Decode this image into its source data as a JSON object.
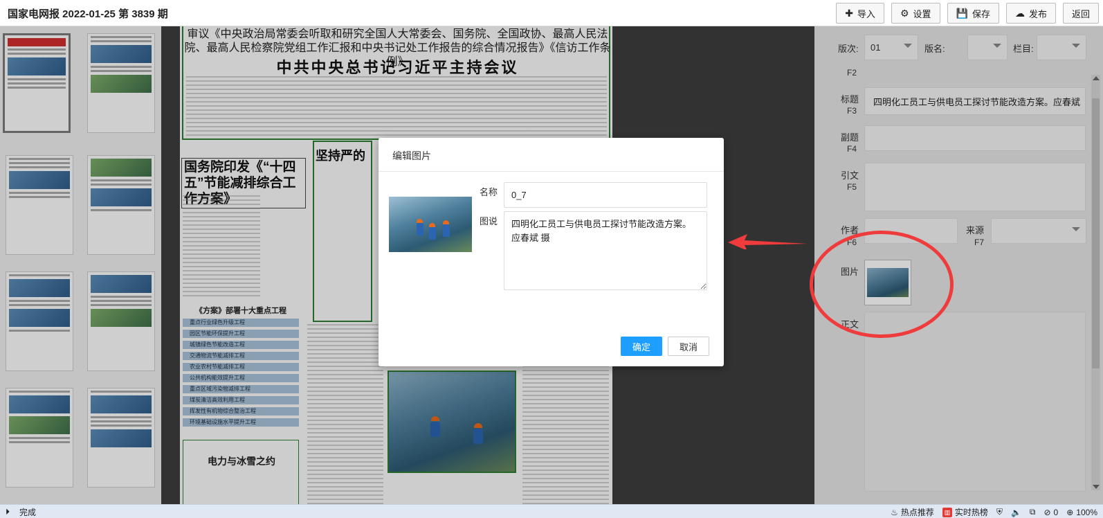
{
  "header": {
    "title": "国家电网报 2022-01-25 第 3839 期",
    "buttons": [
      {
        "label": "导入",
        "icon": "plus-icon"
      },
      {
        "label": "设置",
        "icon": "gear-icon"
      },
      {
        "label": "保存",
        "icon": "save-icon"
      },
      {
        "label": "发布",
        "icon": "cloud-upload-icon"
      },
      {
        "label": "返回",
        "icon": ""
      }
    ]
  },
  "newspaper": {
    "subheadline": "审议《中央政治局常委会听取和研究全国人大常委会、国务院、全国政协、最高人民法院、最高人民检察院党组工作汇报和中央书记处工作报告的综合情况报告》《信访工作条例》",
    "headline": "中共中央总书记习近平主持会议",
    "article2_title": "国务院印发《“十四五”节能减排综合工作方案》",
    "list_title": "《方案》部署十大重点工程",
    "list_items": [
      "重点行业绿色升级工程",
      "园区节能环保提升工程",
      "城镇绿色节能改造工程",
      "交通物流节能减排工程",
      "农业农村节能减排工程",
      "公共机构能效提升工程",
      "重点区域污染物减排工程",
      "煤炭清洁高效利用工程",
      "挥发性有机物综合整治工程",
      "环境基础设施水平提升工程"
    ],
    "box_title": "电力与冰雪之约",
    "article3_title": "坚持严的"
  },
  "right_panel": {
    "edition_label": "版次:",
    "edition_value": "01",
    "edition_name_label": "版名:",
    "column_label": "栏目:",
    "f2_key": "F2",
    "title_label": "标题",
    "title_key": "F3",
    "title_value": "四明化工员工与供电员工探讨节能改造方案。应春斌 摄",
    "subtitle_label": "副题",
    "subtitle_key": "F4",
    "lead_label": "引文",
    "lead_key": "F5",
    "author_label": "作者",
    "author_key": "F6",
    "source_label": "来源",
    "source_key": "F7",
    "image_label": "图片",
    "body_label": "正文"
  },
  "dialog": {
    "title": "编辑图片",
    "name_label": "名称",
    "name_value": "0_7",
    "caption_label": "图说",
    "caption_value": "四明化工员工与供电员工探讨节能改造方案。 应春斌 摄",
    "ok_label": "确定",
    "cancel_label": "取消"
  },
  "status_bar": {
    "status_text": "完成",
    "hot_recommend": "热点推荐",
    "realtime_hot": "实时热榜",
    "badge_count": "0",
    "zoom": "100%"
  },
  "colors": {
    "accent_blue": "#1e9fff",
    "annotation_red": "#ef3b3b",
    "newspaper_green": "#2e7d32"
  }
}
